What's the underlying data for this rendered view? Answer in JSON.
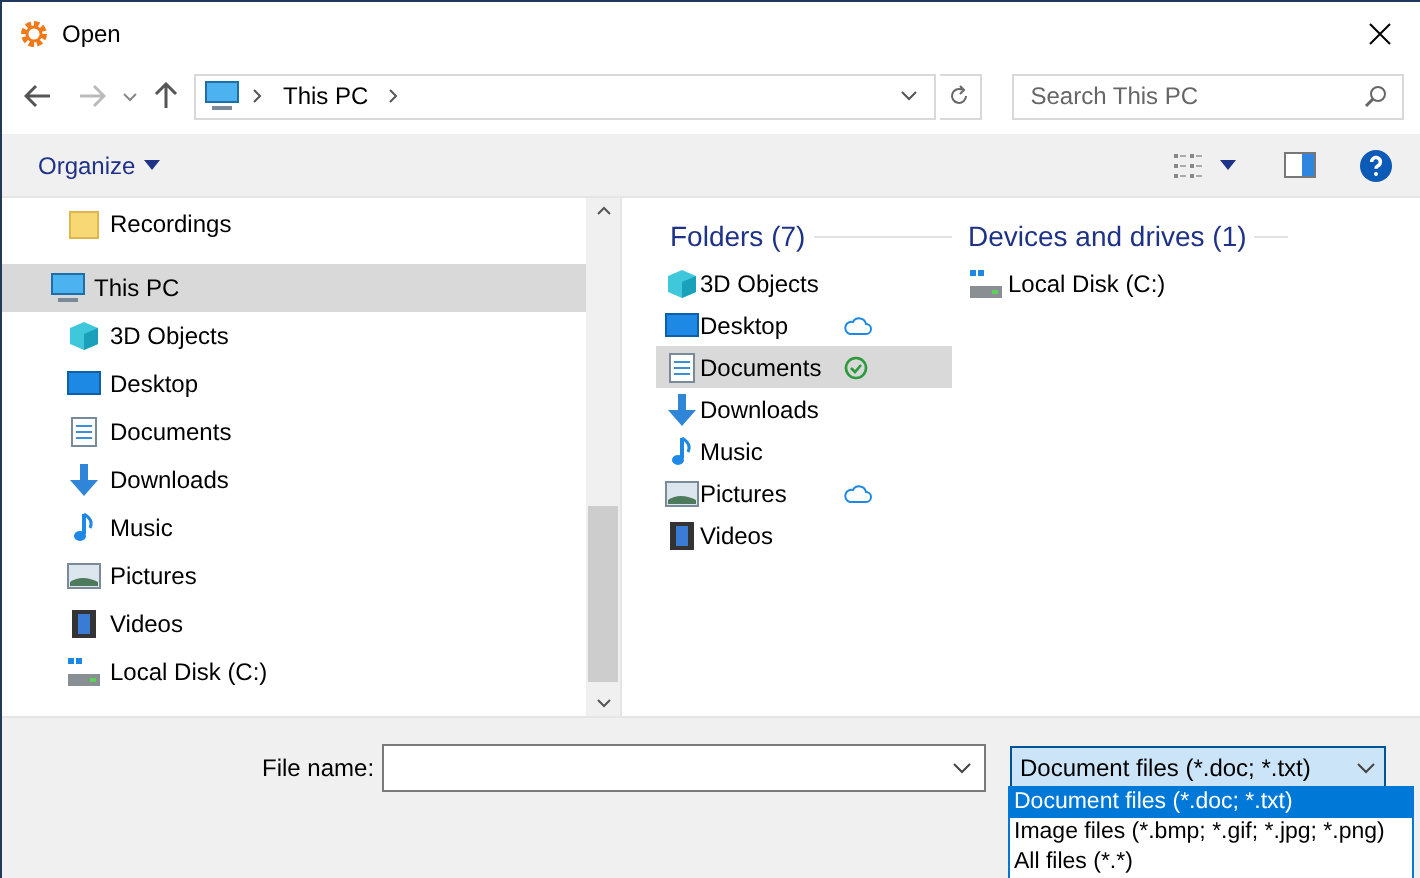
{
  "window": {
    "title": "Open"
  },
  "address": {
    "path": "This PC"
  },
  "search": {
    "placeholder": "Search This PC"
  },
  "toolbar": {
    "organize": "Organize"
  },
  "nav": [
    {
      "label": "Recordings",
      "kind": "folder",
      "selected": false
    },
    {
      "label": "This PC",
      "kind": "pc",
      "selected": true,
      "children": [
        {
          "label": "3D Objects",
          "kind": "cube",
          "selected": false
        },
        {
          "label": "Desktop",
          "kind": "desktop",
          "selected": false
        },
        {
          "label": "Documents",
          "kind": "documents",
          "selected": false
        },
        {
          "label": "Downloads",
          "kind": "downloads",
          "selected": false
        },
        {
          "label": "Music",
          "kind": "music",
          "selected": false
        },
        {
          "label": "Pictures",
          "kind": "pictures",
          "selected": false
        },
        {
          "label": "Videos",
          "kind": "videos",
          "selected": false
        },
        {
          "label": "Local Disk (C:)",
          "kind": "disk",
          "selected": false
        }
      ]
    }
  ],
  "folders": {
    "heading": "Folders (7)",
    "items": [
      {
        "label": "3D Objects",
        "kind": "cube",
        "online_only": false,
        "synced": false,
        "selected": false
      },
      {
        "label": "Desktop",
        "kind": "desktop",
        "online_only": true,
        "synced": false,
        "selected": false
      },
      {
        "label": "Documents",
        "kind": "documents",
        "online_only": false,
        "synced": true,
        "selected": true
      },
      {
        "label": "Downloads",
        "kind": "downloads",
        "online_only": false,
        "synced": false,
        "selected": false
      },
      {
        "label": "Music",
        "kind": "music",
        "online_only": false,
        "synced": false,
        "selected": false
      },
      {
        "label": "Pictures",
        "kind": "pictures",
        "online_only": true,
        "synced": false,
        "selected": false
      },
      {
        "label": "Videos",
        "kind": "videos",
        "online_only": false,
        "synced": false,
        "selected": false
      }
    ]
  },
  "drives": {
    "heading": "Devices and drives (1)",
    "items": [
      {
        "label": "Local Disk (C:)",
        "kind": "disk"
      }
    ]
  },
  "file_name": {
    "label": "File name:"
  },
  "file_type": {
    "value": "Document files (*.doc; *.txt)",
    "options": [
      {
        "label": "Document files (*.doc; *.txt)",
        "selected": true
      },
      {
        "label": "Image files (*.bmp; *.gif; *.jpg; *.png)",
        "selected": false
      },
      {
        "label": "All files (*.*)",
        "selected": false
      }
    ]
  }
}
